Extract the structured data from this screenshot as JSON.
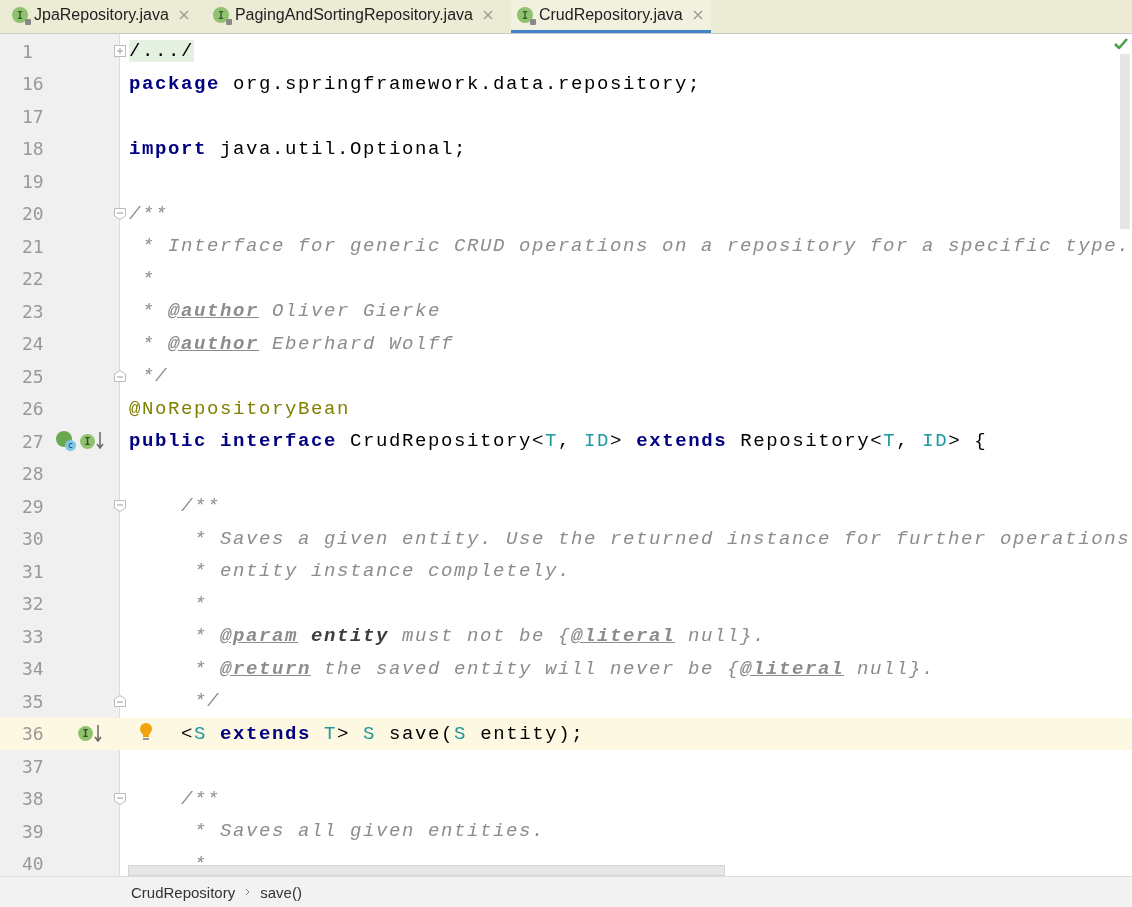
{
  "tabs": [
    {
      "label": "JpaRepository.java",
      "badge": "I",
      "selected": false
    },
    {
      "label": "PagingAndSortingRepository.java",
      "badge": "I",
      "selected": false
    },
    {
      "label": "CrudRepository.java",
      "badge": "I",
      "selected": true
    }
  ],
  "lines": [
    {
      "number": "1",
      "fold": {
        "kind": "collapsed"
      },
      "tokens": [
        {
          "text": "/.../",
          "kind": "folded"
        }
      ]
    },
    {
      "number": "16",
      "tokens": [
        {
          "text": "package",
          "kind": "keyword"
        },
        {
          "text": " org.springframework.data.repository;",
          "kind": "plain"
        }
      ]
    },
    {
      "number": "17"
    },
    {
      "number": "18",
      "tokens": [
        {
          "text": "import",
          "kind": "keyword"
        },
        {
          "text": " java.util.Optional;",
          "kind": "plain"
        }
      ]
    },
    {
      "number": "19"
    },
    {
      "number": "20",
      "fold": {
        "kind": "start"
      },
      "tokens": [
        {
          "text": "/**",
          "kind": "comment"
        }
      ]
    },
    {
      "number": "21",
      "tokens": [
        {
          "text": " * Interface for generic CRUD operations on a repository for a specific type.",
          "kind": "comment"
        }
      ]
    },
    {
      "number": "22",
      "tokens": [
        {
          "text": " *",
          "kind": "comment"
        }
      ]
    },
    {
      "number": "23",
      "tokens": [
        {
          "text": " * ",
          "kind": "comment"
        },
        {
          "text": "@author",
          "kind": "doctag"
        },
        {
          "text": " Oliver Gierke",
          "kind": "comment"
        }
      ]
    },
    {
      "number": "24",
      "tokens": [
        {
          "text": " * ",
          "kind": "comment"
        },
        {
          "text": "@author",
          "kind": "doctag"
        },
        {
          "text": " Eberhard Wolff",
          "kind": "comment"
        }
      ]
    },
    {
      "number": "25",
      "fold": {
        "kind": "end"
      },
      "tokens": [
        {
          "text": " */",
          "kind": "comment"
        }
      ]
    },
    {
      "number": "26",
      "tokens": [
        {
          "text": "@NoRepositoryBean",
          "kind": "annotation"
        }
      ]
    },
    {
      "number": "27",
      "markers": [
        {
          "kind": "implemented",
          "letter": "c"
        },
        {
          "kind": "implements",
          "letter": "I"
        }
      ],
      "tokens": [
        {
          "text": "public interface",
          "kind": "keyword"
        },
        {
          "text": " CrudRepository<",
          "kind": "plain"
        },
        {
          "text": "T",
          "kind": "typeparam"
        },
        {
          "text": ", ",
          "kind": "plain"
        },
        {
          "text": "ID",
          "kind": "typeparam"
        },
        {
          "text": "> ",
          "kind": "plain"
        },
        {
          "text": "extends",
          "kind": "keyword"
        },
        {
          "text": " Repository<",
          "kind": "plain"
        },
        {
          "text": "T",
          "kind": "typeparam"
        },
        {
          "text": ", ",
          "kind": "plain"
        },
        {
          "text": "ID",
          "kind": "typeparam"
        },
        {
          "text": "> {",
          "kind": "plain"
        }
      ]
    },
    {
      "number": "28"
    },
    {
      "number": "29",
      "fold": {
        "kind": "start"
      },
      "tokens": [
        {
          "text": "    /**",
          "kind": "comment"
        }
      ]
    },
    {
      "number": "30",
      "tokens": [
        {
          "text": "     * Saves a given entity. Use the returned instance for further operations",
          "kind": "comment"
        }
      ]
    },
    {
      "number": "31",
      "tokens": [
        {
          "text": "     * entity instance completely.",
          "kind": "comment"
        }
      ]
    },
    {
      "number": "32",
      "tokens": [
        {
          "text": "     *",
          "kind": "comment"
        }
      ]
    },
    {
      "number": "33",
      "tokens": [
        {
          "text": "     * ",
          "kind": "comment"
        },
        {
          "text": "@param",
          "kind": "doctag"
        },
        {
          "text": " entity",
          "kind": "docparam"
        },
        {
          "text": " must not be {",
          "kind": "comment"
        },
        {
          "text": "@literal",
          "kind": "doctag"
        },
        {
          "text": " null}.",
          "kind": "comment"
        }
      ]
    },
    {
      "number": "34",
      "tokens": [
        {
          "text": "     * ",
          "kind": "comment"
        },
        {
          "text": "@return",
          "kind": "doctag"
        },
        {
          "text": " the saved entity will never be {",
          "kind": "comment"
        },
        {
          "text": "@literal",
          "kind": "doctag"
        },
        {
          "text": " null}.",
          "kind": "comment"
        }
      ]
    },
    {
      "number": "35",
      "fold": {
        "kind": "end"
      },
      "tokens": [
        {
          "text": "     */",
          "kind": "comment"
        }
      ]
    },
    {
      "number": "36",
      "current": true,
      "bulb": true,
      "markers": [
        {
          "kind": "implements",
          "letter": "I"
        }
      ],
      "tokens": [
        {
          "text": "    <",
          "kind": "plain"
        },
        {
          "text": "S",
          "kind": "typeparam"
        },
        {
          "text": " extends",
          "kind": "keyword"
        },
        {
          "text": " T",
          "kind": "typeparam"
        },
        {
          "text": "> ",
          "kind": "plain"
        },
        {
          "text": "S",
          "kind": "typeparam"
        },
        {
          "text": " save(",
          "kind": "plain"
        },
        {
          "text": "S",
          "kind": "typeparam"
        },
        {
          "text": " entity);",
          "kind": "plain"
        }
      ]
    },
    {
      "number": "37"
    },
    {
      "number": "38",
      "fold": {
        "kind": "start"
      },
      "tokens": [
        {
          "text": "    /**",
          "kind": "comment"
        }
      ]
    },
    {
      "number": "39",
      "tokens": [
        {
          "text": "     * Saves all given entities.",
          "kind": "comment"
        }
      ]
    },
    {
      "number": "40",
      "tokens": [
        {
          "text": "     *",
          "kind": "comment"
        }
      ]
    }
  ],
  "breadcrumbs": [
    "CrudRepository",
    "save()"
  ]
}
